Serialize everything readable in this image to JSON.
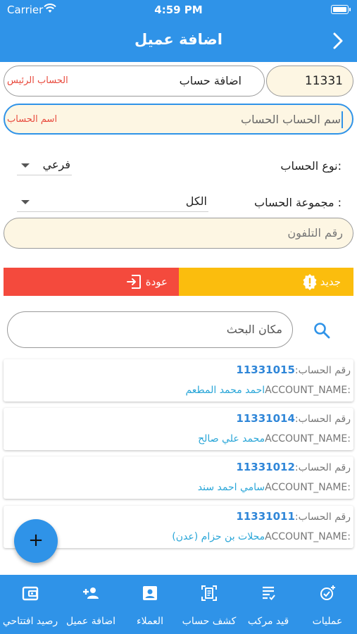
{
  "status_bar": {
    "carrier": "Carrier",
    "time": "4:59 PM"
  },
  "header": {
    "title": "اضافة عميل"
  },
  "form": {
    "account_number": "11331",
    "main_account_value": "اضافة حساب",
    "main_account_label": "الحساب الرئيس",
    "account_name_value": "سم الحساب الحساب",
    "account_name_label": "اسم الحساب",
    "account_type_label": "نوع الحساب:",
    "account_type_value": "فرعي",
    "account_group_label": "مجموعة الحساب :",
    "account_group_value": "الكل",
    "phone_placeholder": "رقم التلفون"
  },
  "actions": {
    "new_label": "جديد",
    "back_label": "عودة"
  },
  "search": {
    "placeholder": "مكان البحث"
  },
  "list": {
    "number_label": "رقم الحساب:",
    "name_label": "ACCOUNT_NAME:",
    "items": [
      {
        "number": "11331015",
        "name": "احمد محمد المطعم"
      },
      {
        "number": "11331014",
        "name": "محمد علي صالح"
      },
      {
        "number": "11331012",
        "name": "سامي احمد سند"
      },
      {
        "number": "11331011",
        "name": "محلات بن حزام (عدن)"
      }
    ]
  },
  "fab": {
    "label": "+"
  },
  "bottom_nav": {
    "items": [
      {
        "label": "عمليات",
        "icon": "add-check-icon"
      },
      {
        "label": "قيد مركب",
        "icon": "receipt-icon"
      },
      {
        "label": "كشف حساب",
        "icon": "document-scan-icon"
      },
      {
        "label": "العملاء",
        "icon": "contact-card-icon"
      },
      {
        "label": "اضافة عميل",
        "icon": "add-person-icon"
      },
      {
        "label": "رصيد افتتاحي",
        "icon": "wallet-icon"
      }
    ]
  },
  "colors": {
    "primary": "#2f93e8",
    "warning": "#fbbd0d",
    "danger": "#f44a3d",
    "field_bg": "#fdf6e3",
    "label_red": "#e84a3d",
    "number_blue": "#2f86d8"
  }
}
